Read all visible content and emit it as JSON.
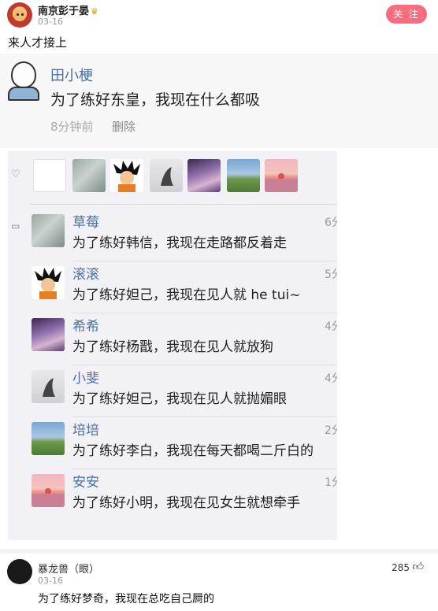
{
  "header": {
    "username": "南京彭于晏",
    "date": "03-16",
    "follow_label": "关 注"
  },
  "post": {
    "text": "来人才接上"
  },
  "screenshot": {
    "top_comment": {
      "name": "田小梗",
      "text": "为了练好东皇，我现在什么都吸",
      "time": "8分钟前",
      "delete_label": "删除"
    },
    "replies": [
      {
        "name": "草莓",
        "text": "为了练好韩信，我现在走路都反着走",
        "time": "6分"
      },
      {
        "name": "滚滚",
        "text": "为了练好妲己，我现在见人就 he tui~",
        "time": "5分"
      },
      {
        "name": "希希",
        "text": "为了练好杨戬，我现在见人就放狗",
        "time": "4分"
      },
      {
        "name": "小斐",
        "text": "为了练好妲己，我现在见人就抛媚眼",
        "time": "4分"
      },
      {
        "name": "培培",
        "text": "为了练好李白，我现在每天都喝二斤白的",
        "time": "2分"
      },
      {
        "name": "安安",
        "text": "为了练好小明，我现在见女生就想牵手",
        "time": "1分"
      }
    ]
  },
  "comment": {
    "name": "暴龙兽（眼）",
    "date": "03-16",
    "likes": "285",
    "text": "为了练好梦奇，我现在总吃自己屙的"
  },
  "icons": {
    "heart": "heart-icon",
    "comment": "comment-icon",
    "thumb": "thumbs-up-icon"
  },
  "colors": {
    "follow_button": "#fa6d7f",
    "name_link": "#4a6fa5"
  }
}
